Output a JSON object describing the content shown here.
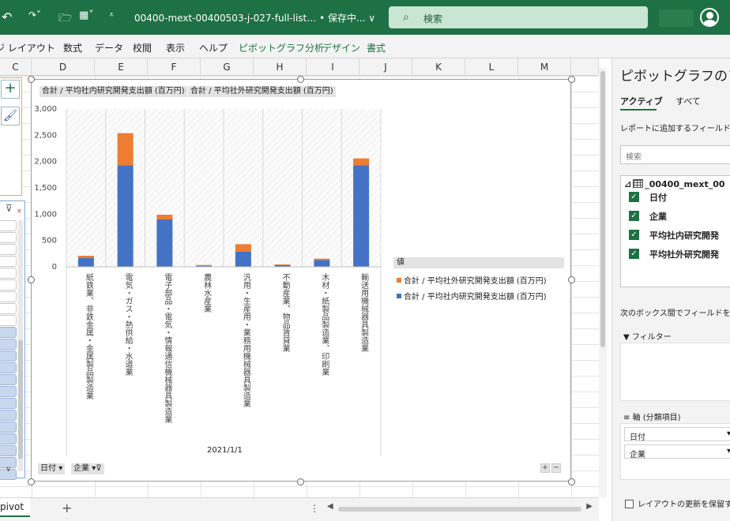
{
  "titlebar": {
    "title": "00400-mext-00400503-j-027-full-list… • 保存中... ∨",
    "search_placeholder": "検索",
    "icons": [
      "undo-icon",
      "redo-icon",
      "open-folder-icon",
      "form-icon",
      "customize-icon",
      "search-icon",
      "avatar-icon"
    ]
  },
  "ribbon": {
    "tabs": [
      "ジ レイアウト",
      "数式",
      "データ",
      "校閲",
      "表示",
      "ヘルプ",
      "ピボットグラフ分析",
      "デザイン",
      "書式"
    ]
  },
  "columns": [
    "C",
    "D",
    "E",
    "F",
    "G",
    "H",
    "I",
    "J",
    "K",
    "L",
    "M"
  ],
  "chart": {
    "value_button_1": "合計 / 平均社内研究開発支出額 (百万円)",
    "value_button_2": "合計 / 平均社外研究開発支出額 (百万円)",
    "legend_title": "値",
    "date_label": "2021/1/1",
    "field_date": "日付",
    "field_company": "企業",
    "zoom_plus": "+",
    "zoom_minus": "−"
  },
  "chart_data": {
    "type": "bar",
    "stacked": true,
    "categories": [
      "紙鉄業、非鉄金属・金属製品製造業",
      "電気・ガス・熱供給・水道業",
      "電子部品・電気・情報通信機械器具製造業",
      "農林水産業",
      "汎用・生産用・業務用機械器具製造業",
      "不動産業、物品賃貸業",
      "木材・紙製品製造業、印刷業",
      "輸送用機械器具製造業"
    ],
    "series": [
      {
        "name": "合計 / 平均社内研究開発支出額 (百万円)",
        "color": "#4472c4",
        "values": [
          170,
          1930,
          900,
          20,
          290,
          30,
          130,
          1930
        ]
      },
      {
        "name": "合計 / 平均社外研究開発支出額 (百万円)",
        "color": "#ed7d31",
        "values": [
          40,
          610,
          90,
          15,
          140,
          15,
          25,
          130
        ]
      }
    ],
    "yticks": [
      "3,000",
      "2,500",
      "2,000",
      "1,500",
      "1,000",
      "500",
      "0"
    ],
    "ylim": [
      0,
      3000
    ],
    "legend_position": "right",
    "legend_order": [
      1,
      0
    ],
    "grid": true
  },
  "pane": {
    "title": "ピボットグラフのフィ",
    "tab_active": "アクティブ",
    "tab_all": "すべて",
    "hint": "レポートに追加するフィールドを選",
    "search_placeholder": "検索",
    "table_name": "_00400_mext_00",
    "fields": [
      "日付",
      "企業",
      "平均社内研究開発",
      "平均社外研究開発"
    ],
    "between": "次のボックス間でフィールドをドラ",
    "filter_label": "フィルター",
    "axis_label": "軸 (分類項目)",
    "axis_items": [
      "日付",
      "企業"
    ],
    "defer_label": "レイアウトの更新を保留す"
  },
  "sheet": {
    "tab_name": "pivot"
  }
}
